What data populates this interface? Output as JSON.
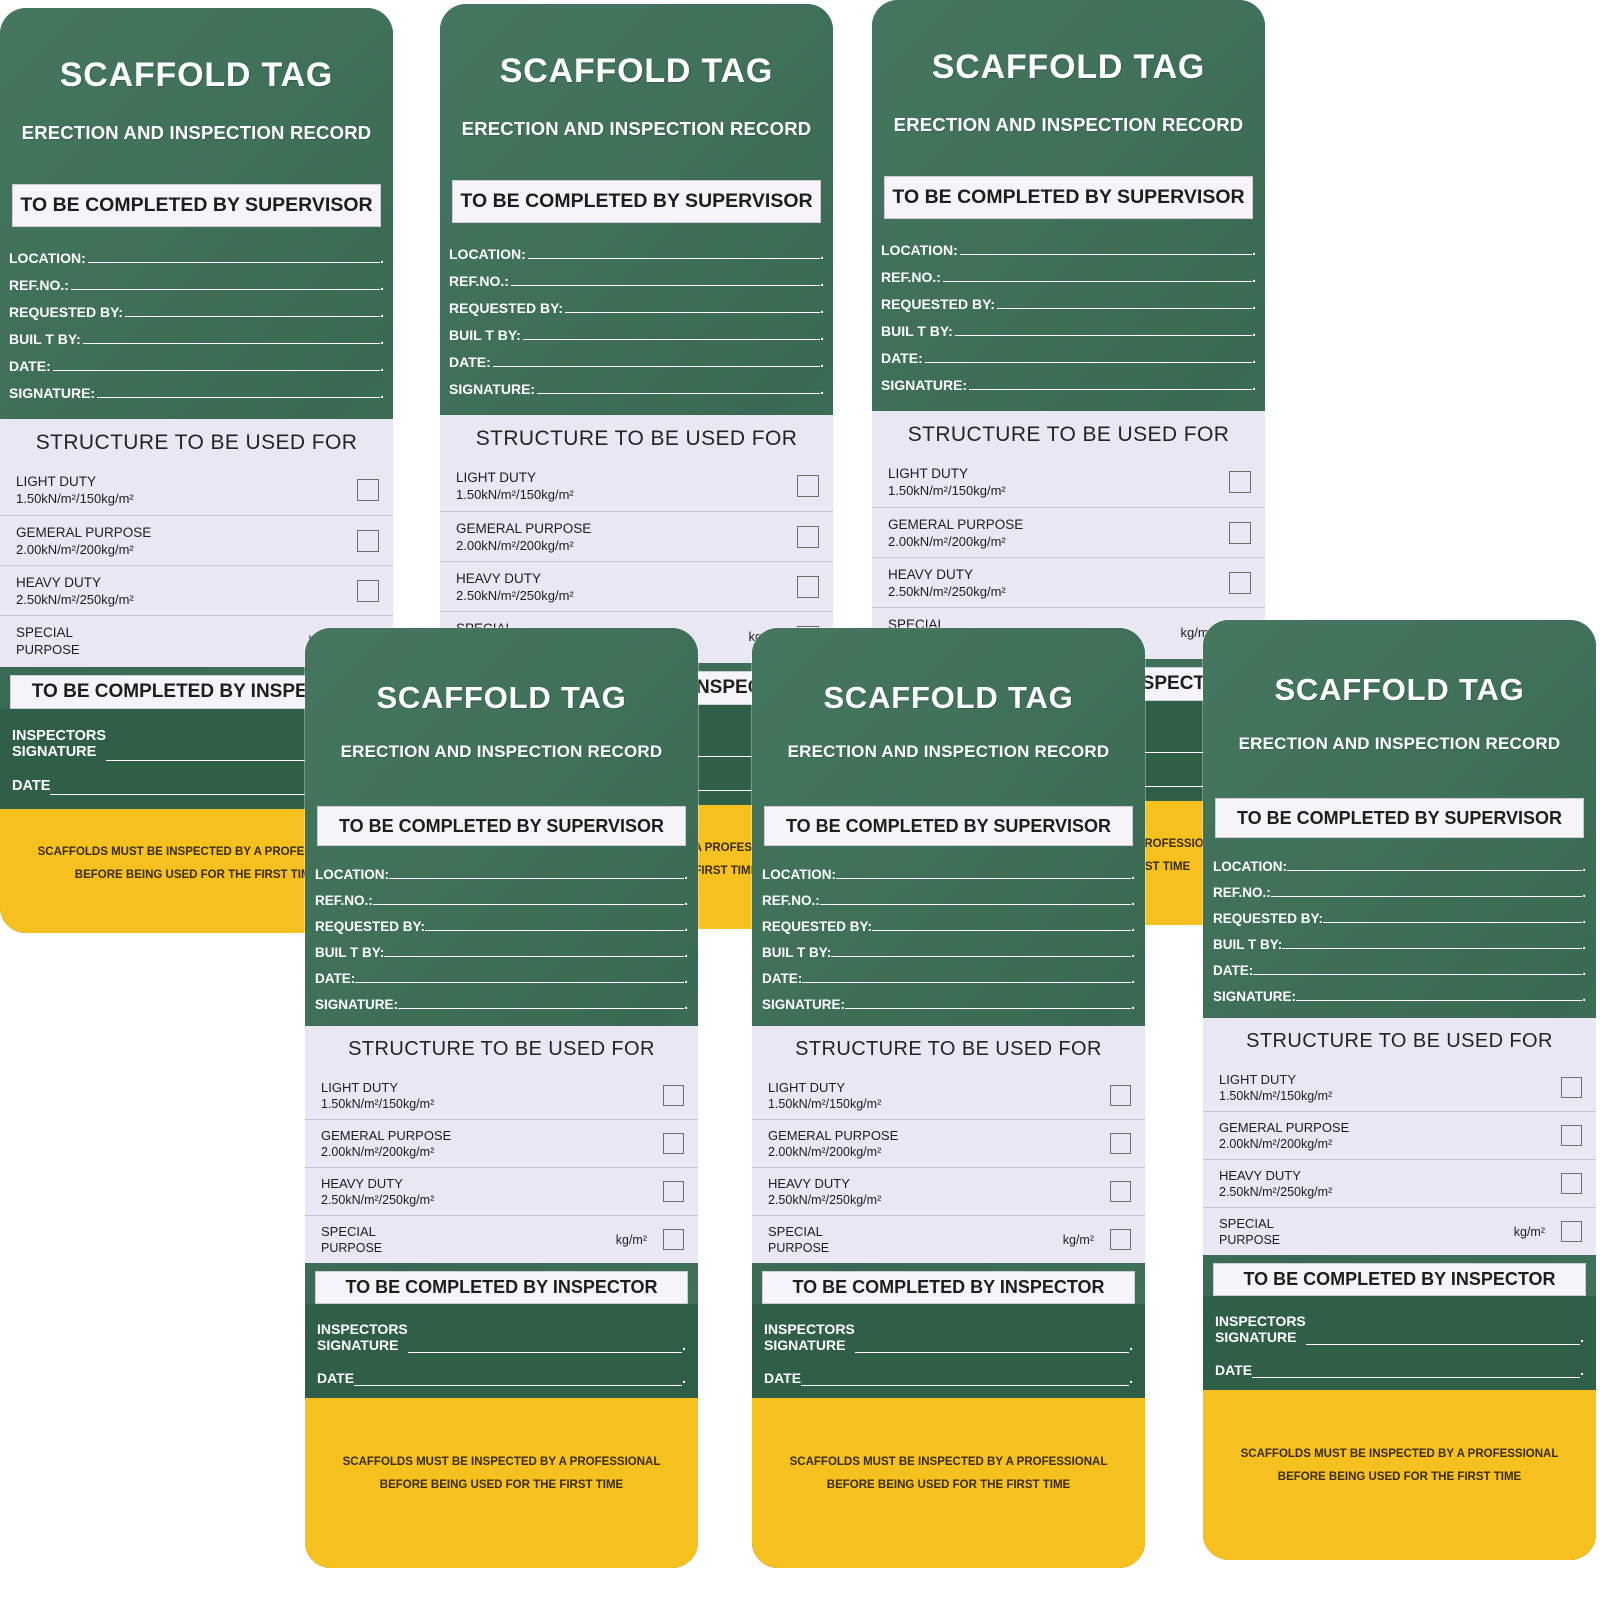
{
  "product": {
    "title": "SCAFFOLD TAG",
    "subtitle": "ERECTION AND INSPECTION RECORD"
  },
  "supervisor_section": {
    "banner": "TO BE COMPLETED BY SUPERVISOR",
    "fields": [
      {
        "label": "LOCATION:"
      },
      {
        "label": "REF.NO.:"
      },
      {
        "label": "REQUESTED BY:"
      },
      {
        "label": "BUIL T BY:"
      },
      {
        "label": "DATE:"
      },
      {
        "label": "SIGNATURE:"
      }
    ],
    "line_end_mark": "."
  },
  "structure_section": {
    "title": "STRUCTURE TO BE USED FOR",
    "duties": [
      {
        "name": "LIGHT DUTY",
        "load": "1.50kN/m²/150kg/m²",
        "unit": ""
      },
      {
        "name": "GEMERAL PURPOSE",
        "load": "2.00kN/m²/200kg/m²",
        "unit": ""
      },
      {
        "name": "HEAVY DUTY",
        "load": "2.50kN/m²/250kg/m²",
        "unit": ""
      },
      {
        "name": "SPECIAL",
        "load": "PURPOSE",
        "unit": "kg/m²"
      }
    ]
  },
  "inspector_section": {
    "banner": "TO BE COMPLETED BY INSPECTOR",
    "signature_label_line1": "INSPECTORS",
    "signature_label_line2": "SIGNATURE",
    "date_label": "DATE",
    "line_end_mark": "."
  },
  "footer": {
    "line1": "SCAFFOLDS MUST BE INSPECTED BY A PROFESSIONAL",
    "line2": "BEFORE BEING USED FOR THE FIRST TIME"
  },
  "colors": {
    "tag_green": "#3d7057",
    "inspector_green": "#2f6047",
    "footer_yellow": "#f6c01f",
    "structure_lavender": "#eae7f5",
    "banner_white": "#f6f4fa",
    "text_white": "#ffffff",
    "text_dark": "#1d1d1d"
  },
  "layout": {
    "tag_count": 6,
    "rows": 2,
    "columns": 3,
    "background": "#ffffff"
  }
}
